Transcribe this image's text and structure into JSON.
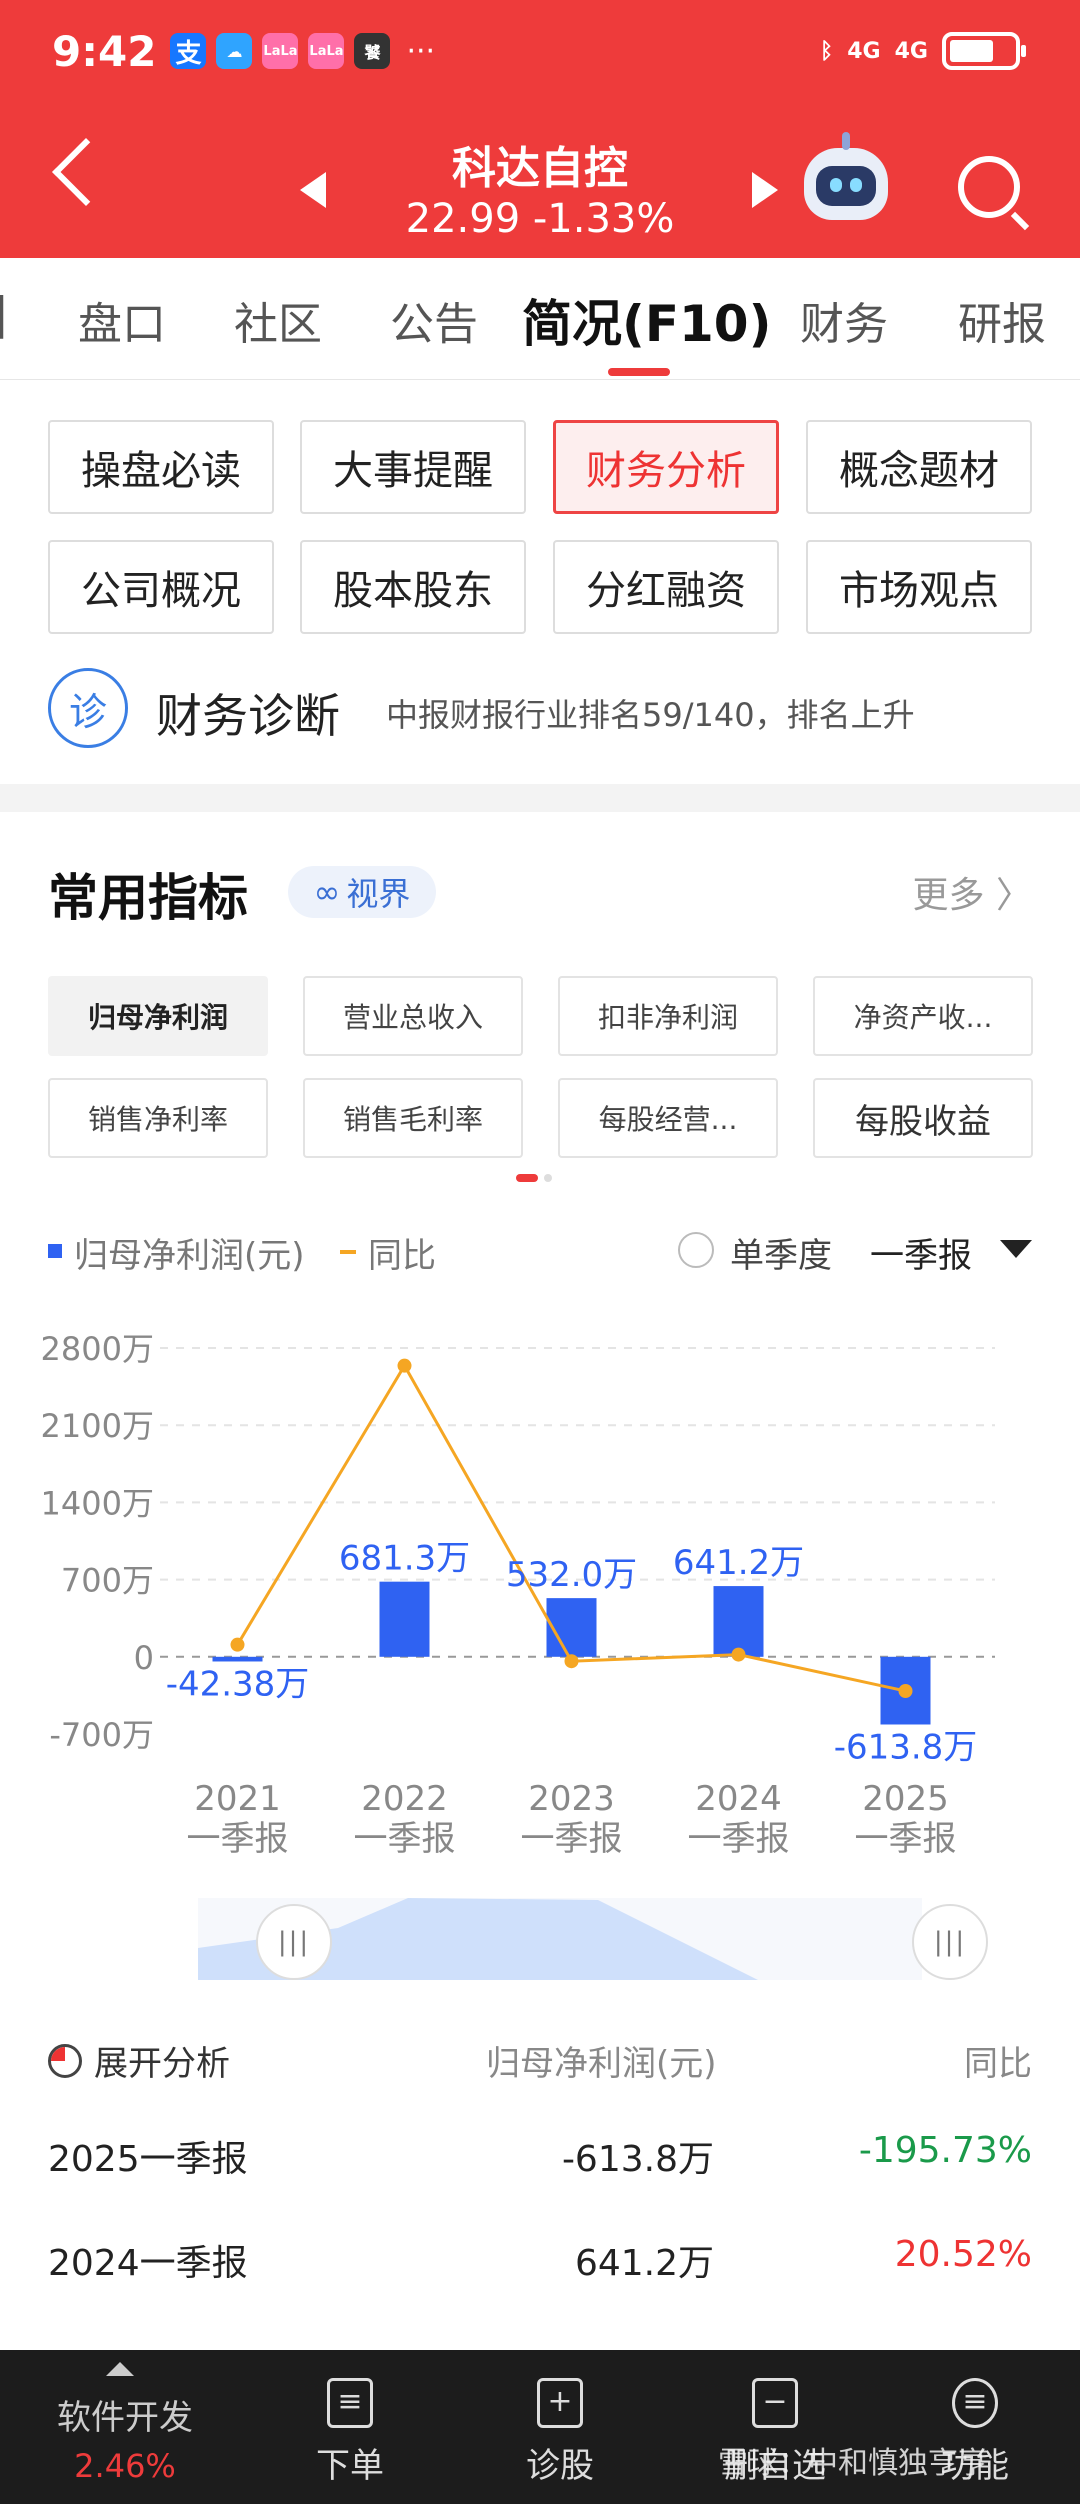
{
  "status": {
    "time": "9:42",
    "more": "···",
    "network": "4G",
    "network2": "4G"
  },
  "header": {
    "title": "科达自控",
    "price": "22.99 -1.33%"
  },
  "tabs": [
    "盘口",
    "社区",
    "公告",
    "简况(F10)",
    "财务",
    "研报"
  ],
  "buttons": [
    "操盘必读",
    "大事提醒",
    "财务分析",
    "概念题材",
    "公司概况",
    "股本股东",
    "分红融资",
    "市场观点"
  ],
  "diagnosis": {
    "icon": "诊",
    "title": "财务诊断",
    "text": "中报财报行业排名59/140，排名上升"
  },
  "section": {
    "title": "常用指标",
    "vision": "视界",
    "more": "更多 〉"
  },
  "metrics": [
    "归母净利润",
    "营业总收入",
    "扣非净利润",
    "净资产收...",
    "销售净利率",
    "销售毛利率",
    "每股经营...",
    "每股收益"
  ],
  "legend": {
    "series1": "归母净利润(元)",
    "series2": "同比",
    "single_quarter": "单季度",
    "period": "一季报"
  },
  "chart_data": {
    "type": "bar",
    "categories": [
      "2021\n一季报",
      "2022\n一季报",
      "2023\n一季报",
      "2024\n一季报",
      "2025\n一季报"
    ],
    "year_labels": [
      "2021",
      "2022",
      "2023",
      "2024",
      "2025"
    ],
    "period_label": "一季报",
    "yticks": [
      "2800万",
      "2100万",
      "1400万",
      "700万",
      "0",
      "-700万"
    ],
    "ylim": [
      -700,
      2800
    ],
    "series": [
      {
        "name": "归母净利润(元)",
        "type": "bar",
        "values": [
          -42.38,
          681.3,
          532.0,
          641.2,
          -613.8
        ],
        "labels": [
          "-42.38万",
          "681.3万",
          "532.0万",
          "641.2万",
          "-613.8万"
        ],
        "color": "#2f62f2"
      },
      {
        "name": "同比",
        "type": "line",
        "values": [
          110,
          2640,
          -40,
          20,
          -310
        ],
        "color": "#f5a623"
      }
    ]
  },
  "table": {
    "headers": [
      "展开分析",
      "归母净利润(元)",
      "同比"
    ],
    "rows": [
      {
        "period": "2025一季报",
        "value": "-613.8万",
        "yoy": "-195.73%",
        "color": "#1a9a4a"
      },
      {
        "period": "2024一季报",
        "value": "641.2万",
        "yoy": "20.52%",
        "color": "#e33"
      }
    ]
  },
  "bottom": {
    "stock_name": "软件开发",
    "stock_change": "2.46%",
    "items": [
      "下单",
      "诊股",
      "删自选",
      "功能"
    ]
  },
  "watermark": "雪球：中和慎独亨亨"
}
